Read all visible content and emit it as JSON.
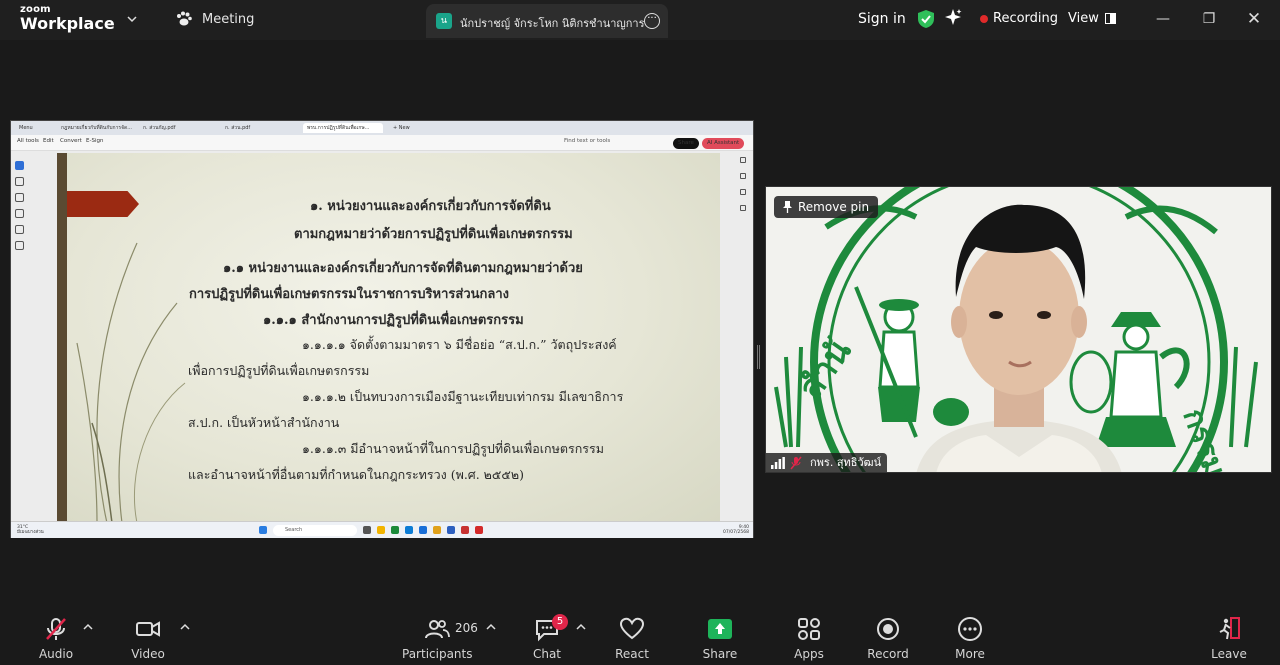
{
  "app": {
    "brand_small": "zoom",
    "brand_big": "Workplace"
  },
  "topbar": {
    "meeting_label": "Meeting",
    "tab_avatar": "น",
    "tab_title": "นักปราชญ์ จักระโหก นิติกรชำนาญการ",
    "sign_in": "Sign in",
    "recording": "Recording",
    "view": "View",
    "colors": {
      "recording_dot": "#e02a2a",
      "shield": "#2fbf5a"
    }
  },
  "shared_screen": {
    "browser_tabs": [
      "Menu",
      "กฎหมายเกี่ยวกับที่ดินกับการจัด...",
      "ก. ส่วนกัญ.pdf",
      "ก. ส่วน.pdf",
      "พรบ.การปฏิรูปที่ดินเพื่อเกษ...",
      "+ New"
    ],
    "pdf_menu": [
      "All tools",
      "Edit",
      "Convert",
      "E-Sign"
    ],
    "find_text": "Find text or tools",
    "share_pill": "Share",
    "ai_pill": "AI Assistant",
    "slide_lines": [
      "๑. หน่วยงานและองค์กรเกี่ยวกับการจัดที่ดิน",
      "ตามกฎหมายว่าด้วยการปฏิรูปที่ดินเพื่อเกษตรกรรม",
      "๑.๑ หน่วยงานและองค์กรเกี่ยวกับการจัดที่ดินตามกฎหมายว่าด้วย",
      "การปฏิรูปที่ดินเพื่อเกษตรกรรมในราชการบริหารส่วนกลาง",
      "๑.๑.๑ สำนักงานการปฏิรูปที่ดินเพื่อเกษตรกรรม",
      "๑.๑.๑.๑ จัดตั้งตามมาตรา ๖ มีชื่อย่อ “ส.ป.ก.” วัตถุประสงค์",
      "เพื่อการปฏิรูปที่ดินเพื่อเกษตรกรรม",
      "๑.๑.๑.๒ เป็นทบวงการเมืองมีฐานะเทียบเท่ากรม มีเลขาธิการ",
      "ส.ป.ก. เป็นหัวหน้าสำนักงาน",
      "๑.๑.๑.๓ มีอำนาจหน้าที่ในการปฏิรูปที่ดินเพื่อเกษตรกรรม",
      "และอำนาจหน้าที่อื่นตามที่กำหนดในกฎกระทรวง (พ.ศ. ๒๕๕๒)"
    ],
    "taskbar": {
      "weather_temp": "31°C",
      "weather_desc": "มีเมฆบางส่วน",
      "search": "Search",
      "time": "9:40",
      "date": "07/07/2568"
    }
  },
  "video": {
    "remove_pin": "Remove pin",
    "participant_name": "กพร. สุทธิวัฒน์",
    "logo_text_left": "สำนั",
    "logo_text_right": "กรรม",
    "logo_text_right2": "ธรรม"
  },
  "toolbar": {
    "audio": "Audio",
    "video": "Video",
    "participants": "Participants",
    "participants_count": "206",
    "chat": "Chat",
    "chat_badge": "5",
    "react": "React",
    "share": "Share",
    "apps": "Apps",
    "record": "Record",
    "more": "More",
    "leave": "Leave",
    "colors": {
      "share": "#1eb45a",
      "muted": "#e0264a"
    }
  }
}
